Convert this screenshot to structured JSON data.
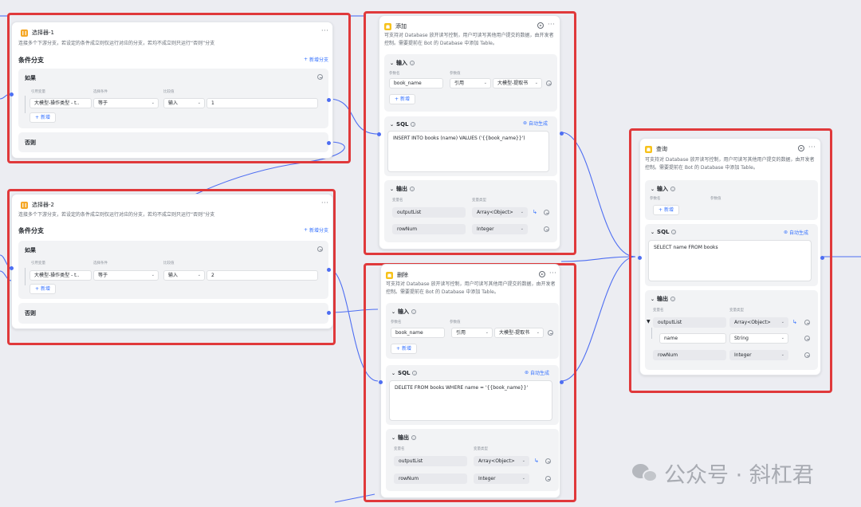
{
  "colors": {
    "highlight": "#e0393b",
    "accent": "#3370ff",
    "wire": "#4e6ef2",
    "canvas": "#ecedf2"
  },
  "selector1": {
    "title": "选择器-1",
    "desc": "连接多个下游分支，若设定的条件成立则仅运行对应的分支，若均不成立则只运行“否则”分支",
    "branch_title": "条件分支",
    "add_branch": "新增分支",
    "if_label": "如果",
    "col_var": "引用变量",
    "col_op": "选择条件",
    "col_val": "比较值",
    "var_value": "大模型-操作类型 - t..",
    "op_value": "等于",
    "val_type": "输入",
    "val_value": "1",
    "add_label": "新增",
    "else_label": "否则"
  },
  "selector2": {
    "title": "选择器-2",
    "desc": "连接多个下游分支，若设定的条件成立则仅运行对应的分支，若均不成立则只运行“否则”分支",
    "branch_title": "条件分支",
    "add_branch": "新增分支",
    "if_label": "如果",
    "col_var": "引用变量",
    "col_op": "选择条件",
    "col_val": "比较值",
    "var_value": "大模型-操作类型 - t..",
    "op_value": "等于",
    "val_type": "输入",
    "val_value": "2",
    "add_label": "新增",
    "else_label": "否则"
  },
  "add_node": {
    "title": "添加",
    "desc": "可支持对 Database 放开读写控制，用户可读写其他用户提交的数据，由开发者控制。需要提前在 Bot 的 Database 中添加 Table。",
    "input_title": "输入",
    "col_name": "参数名",
    "col_value": "参数值",
    "param_name": "book_name",
    "ref_type": "引用",
    "ref_value": "大模型-提取书",
    "add_label": "新增",
    "sql_title": "SQL",
    "auto_gen": "自动生成",
    "sql": "INSERT INTO books (name) VALUES ('{{book_name}}')",
    "output_title": "输出",
    "out_col_name": "变量名",
    "out_col_type": "变量类型",
    "outputs": [
      {
        "name": "outputList",
        "type": "Array<Object>"
      },
      {
        "name": "rowNum",
        "type": "Integer"
      }
    ]
  },
  "delete_node": {
    "title": "删除",
    "desc": "可支持对 Database 放开读写控制，用户可读写其他用户提交的数据，由开发者控制。需要提前在 Bot 的 Database 中添加 Table。",
    "input_title": "输入",
    "col_name": "参数名",
    "col_value": "参数值",
    "param_name": "book_name",
    "ref_type": "引用",
    "ref_value": "大模型-提取书",
    "add_label": "新增",
    "sql_title": "SQL",
    "auto_gen": "自动生成",
    "sql": "DELETE FROM books WHERE name = '{{book_name}}'",
    "output_title": "输出",
    "out_col_name": "变量名",
    "out_col_type": "变量类型",
    "outputs": [
      {
        "name": "outputList",
        "type": "Array<Object>"
      },
      {
        "name": "rowNum",
        "type": "Integer"
      }
    ]
  },
  "query_node": {
    "title": "查询",
    "desc": "可支持对 Database 放开读写控制，用户可读写其他用户提交的数据，由开发者控制。需要提前在 Bot 的 Database 中添加 Table。",
    "input_title": "输入",
    "col_name": "参数名",
    "col_value": "参数值",
    "add_label": "新增",
    "sql_title": "SQL",
    "auto_gen": "自动生成",
    "sql": "SELECT name FROM books",
    "output_title": "输出",
    "out_col_name": "变量名",
    "out_col_type": "变量类型",
    "outputs": [
      {
        "name": "outputList",
        "type": "Array<Object>"
      },
      {
        "name": "name",
        "type": "String"
      },
      {
        "name": "rowNum",
        "type": "Integer"
      }
    ]
  },
  "watermark": {
    "text": "公众号 · 斜杠君"
  }
}
